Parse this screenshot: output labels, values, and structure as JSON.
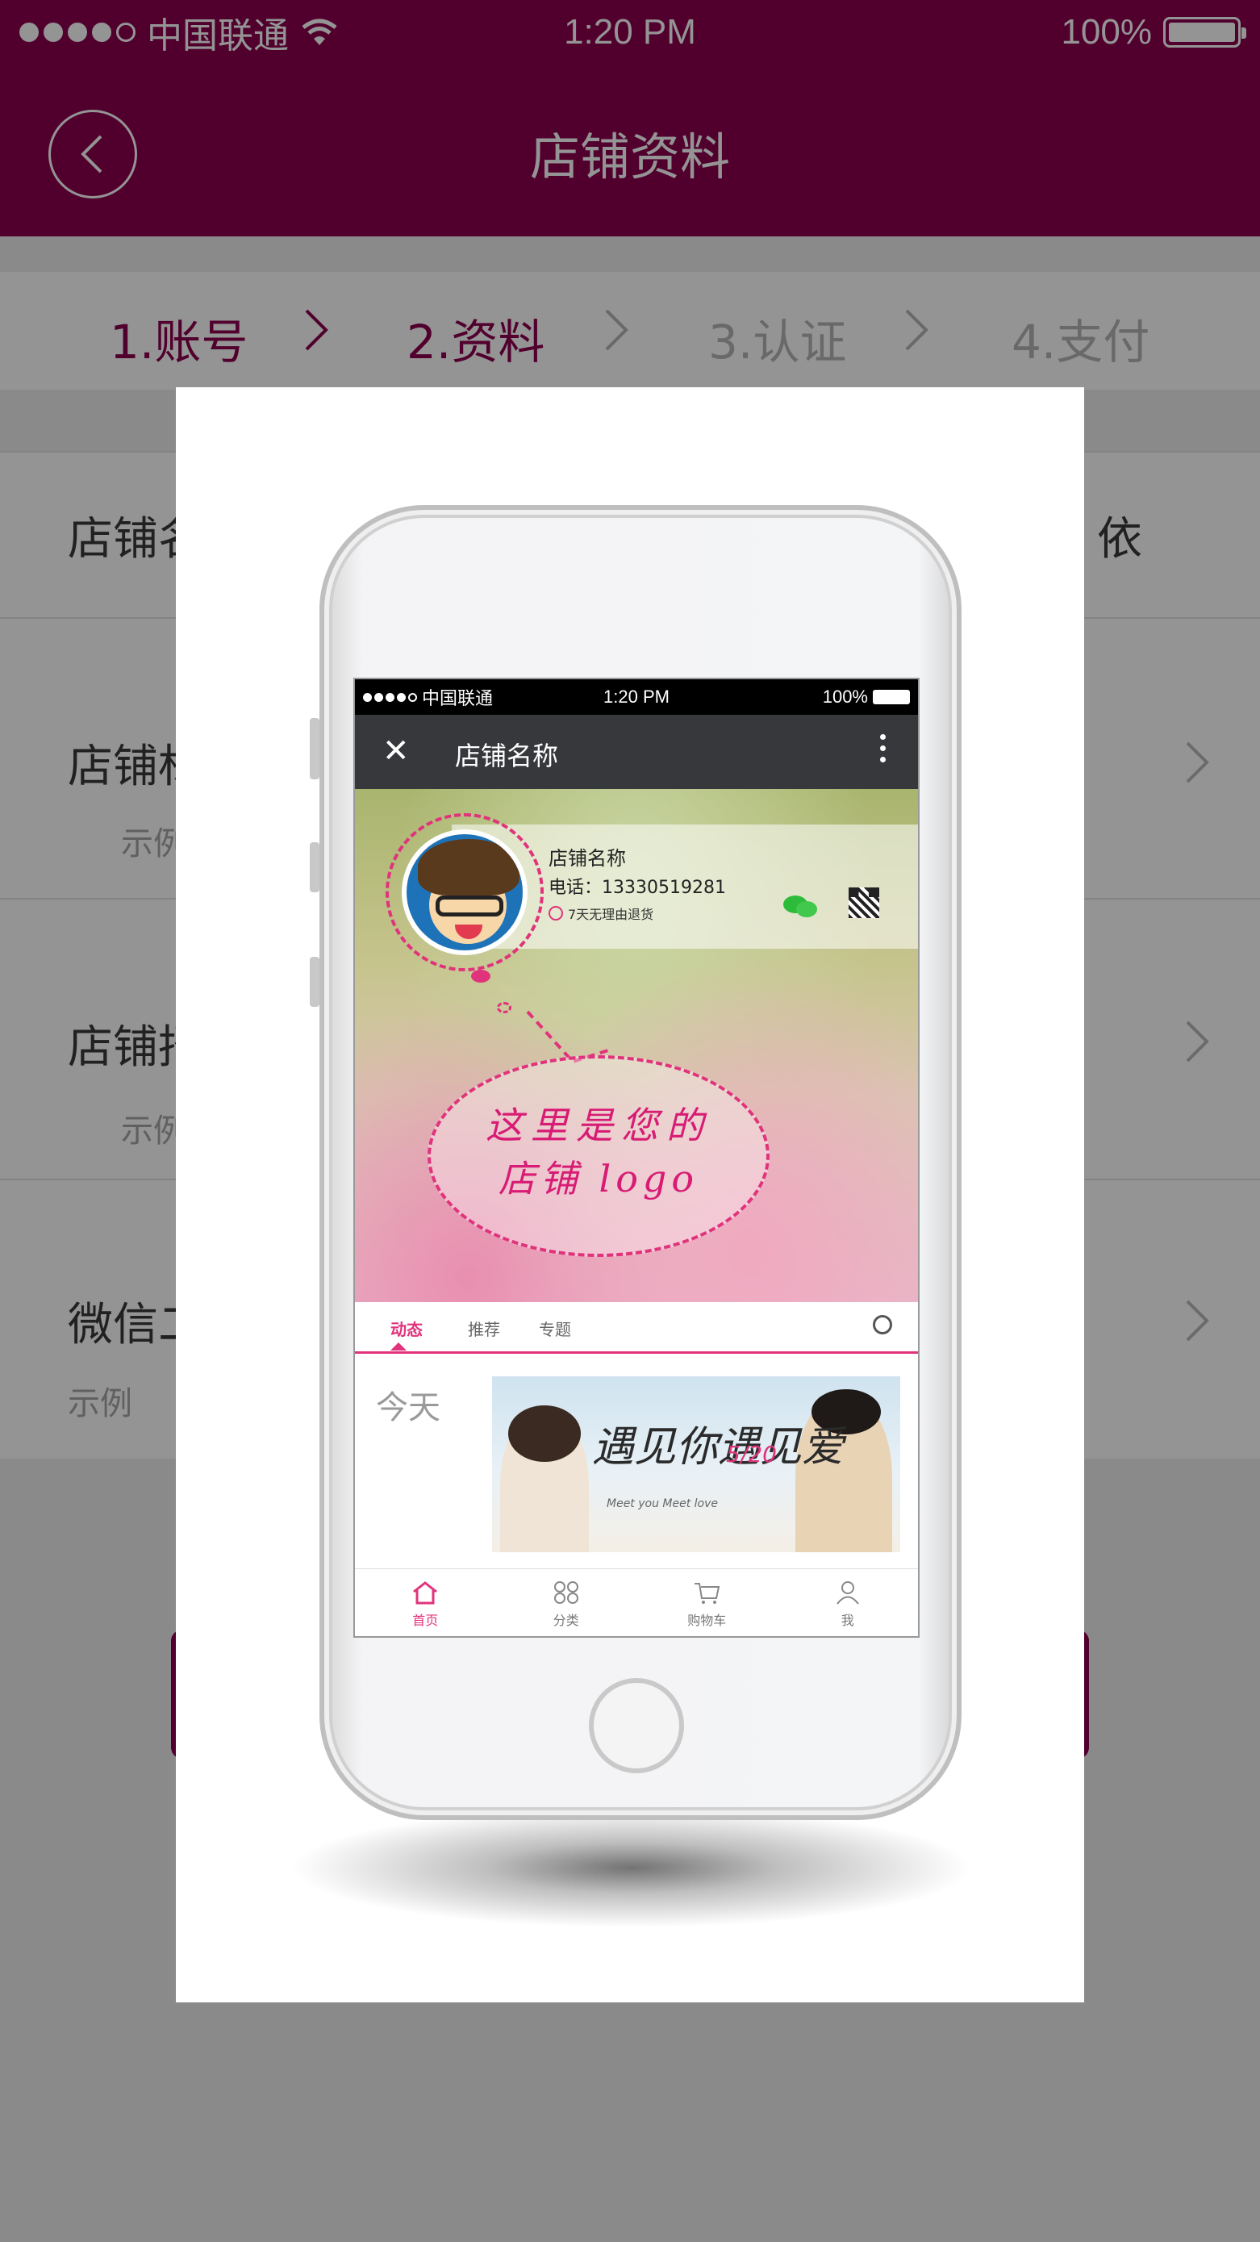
{
  "status_bar": {
    "carrier": "中国联通",
    "time": "1:20 PM",
    "battery": "100%"
  },
  "nav": {
    "title": "店铺资料"
  },
  "steps": [
    {
      "label": "1.账号",
      "state": "done"
    },
    {
      "label": "2.资料",
      "state": "active"
    },
    {
      "label": "3.认证",
      "state": "pending"
    },
    {
      "label": "4.支付",
      "state": "pending"
    }
  ],
  "form": {
    "rows": [
      {
        "label": "店铺名",
        "value": "依"
      },
      {
        "label": "店铺标",
        "hint": "示例"
      },
      {
        "label": "店铺招",
        "hint": "示例"
      },
      {
        "label": "微信二",
        "hint": "示例"
      }
    ]
  },
  "preview": {
    "status_bar": {
      "carrier": "中国联通",
      "time": "1:20 PM",
      "battery": "100%"
    },
    "nav_title": "店铺名称",
    "shop_name": "店铺名称",
    "shop_phone": "电话：13330519281",
    "return_policy": "7天无理由退货",
    "bubble_line1": "这里是您的",
    "bubble_line2": "店铺 logo",
    "tabs": [
      "动态",
      "推荐",
      "专题"
    ],
    "today_label": "今天",
    "banner": {
      "title": "遇见你遇见爱",
      "date": "5/20",
      "sub": "Meet you Meet love"
    },
    "tabbar": [
      "首页",
      "分类",
      "购物车",
      "我"
    ]
  },
  "colors": {
    "brand": "#8c0050",
    "accent_pink": "#e0337b",
    "inactive_step": "#b5b5b5"
  }
}
